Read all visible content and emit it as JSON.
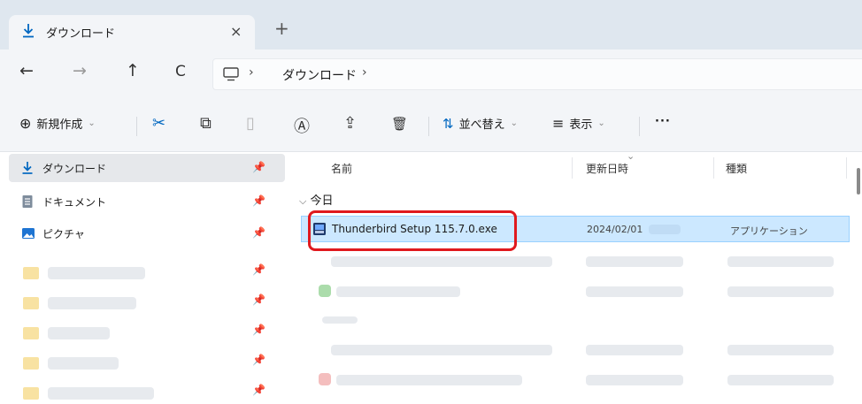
{
  "tab": {
    "title": "ダウンロード",
    "close": "×",
    "new_tab": "+"
  },
  "nav": {
    "back": "←",
    "forward": "→",
    "up": "↑",
    "refresh": "C"
  },
  "address": {
    "separator": "›",
    "crumb": "ダウンロード"
  },
  "toolbar": {
    "new_label": "新規作成",
    "new_icon": "⊕",
    "caret": "⌄",
    "sort_label": "並べ替え",
    "sort_icon": "⇅",
    "view_label": "表示",
    "view_icon": "≡",
    "more": "···",
    "cut_icon": "✂",
    "copy_icon": "⧉",
    "paste_icon": "▯",
    "rename_icon": "Ⓐ",
    "share_icon": "⇪",
    "delete_icon": "🗑"
  },
  "sidebar": {
    "pin": "📌",
    "items": [
      {
        "label": "ダウンロード",
        "icon": "download-icon"
      },
      {
        "label": "ドキュメント",
        "icon": "document-icon"
      },
      {
        "label": "ピクチャ",
        "icon": "picture-icon"
      }
    ]
  },
  "filelist": {
    "headers": {
      "name": "名前",
      "modified": "更新日時",
      "type": "種類"
    },
    "group": "今日",
    "group_chevron": "⌵",
    "selected_file": {
      "name": "Thunderbird Setup 115.7.0.exe",
      "modified": "2024/02/01",
      "type": "アプリケーション"
    }
  },
  "colors": {
    "accent": "#0067c0",
    "highlight": "#e0191e",
    "selection": "#cce8ff"
  }
}
